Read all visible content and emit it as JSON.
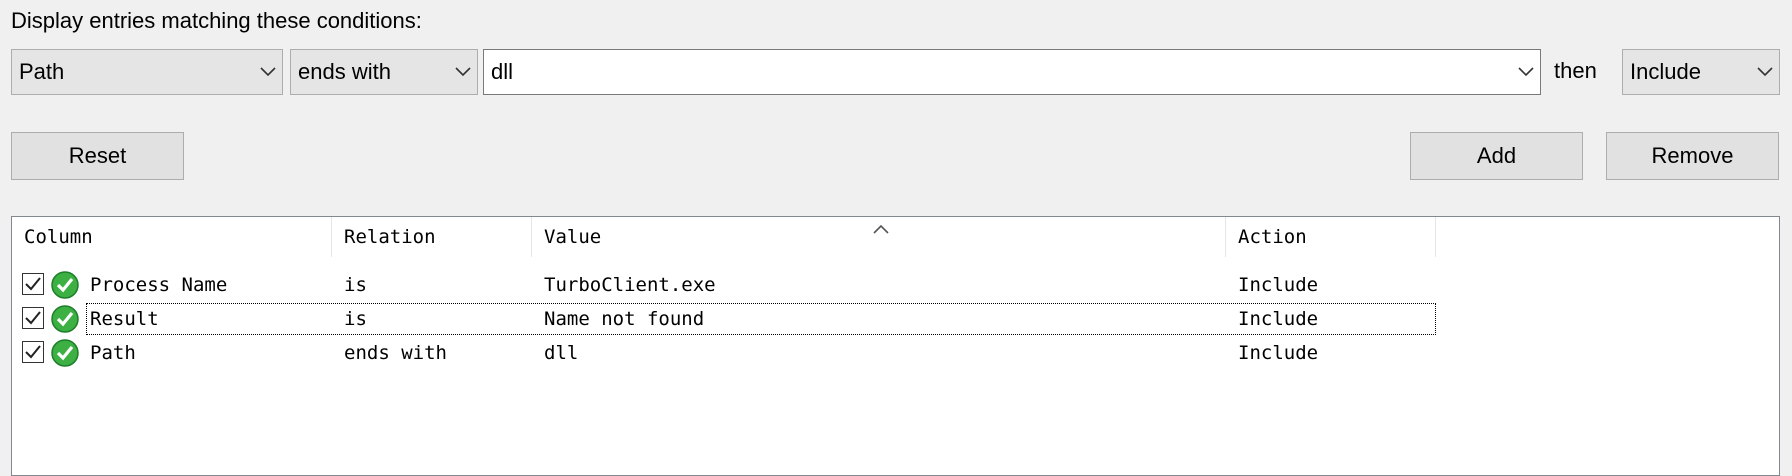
{
  "prompt": "Display entries matching these conditions:",
  "filter": {
    "column": "Path",
    "relation": "ends with",
    "value": "dll",
    "then_label": "then",
    "action": "Include"
  },
  "buttons": {
    "reset": "Reset",
    "add": "Add",
    "remove": "Remove"
  },
  "list": {
    "headers": {
      "column": "Column",
      "relation": "Relation",
      "value": "Value",
      "action": "Action"
    },
    "rows": [
      {
        "column": "Process Name",
        "relation": "is",
        "value": "TurboClient.exe",
        "action": "Include",
        "checked": true
      },
      {
        "column": "Result",
        "relation": "is",
        "value": "Name not found",
        "action": "Include",
        "checked": true
      },
      {
        "column": "Path",
        "relation": "ends with",
        "value": "dll",
        "action": "Include",
        "checked": true
      }
    ]
  },
  "icons": {
    "dropdown": "chevron-down-icon",
    "checkbox": "checkbox-checked-icon",
    "status": "green-check-icon",
    "sort": "sort-ascending-icon"
  },
  "colors": {
    "status_green": "#3cb043",
    "background": "#f0f0f0"
  }
}
